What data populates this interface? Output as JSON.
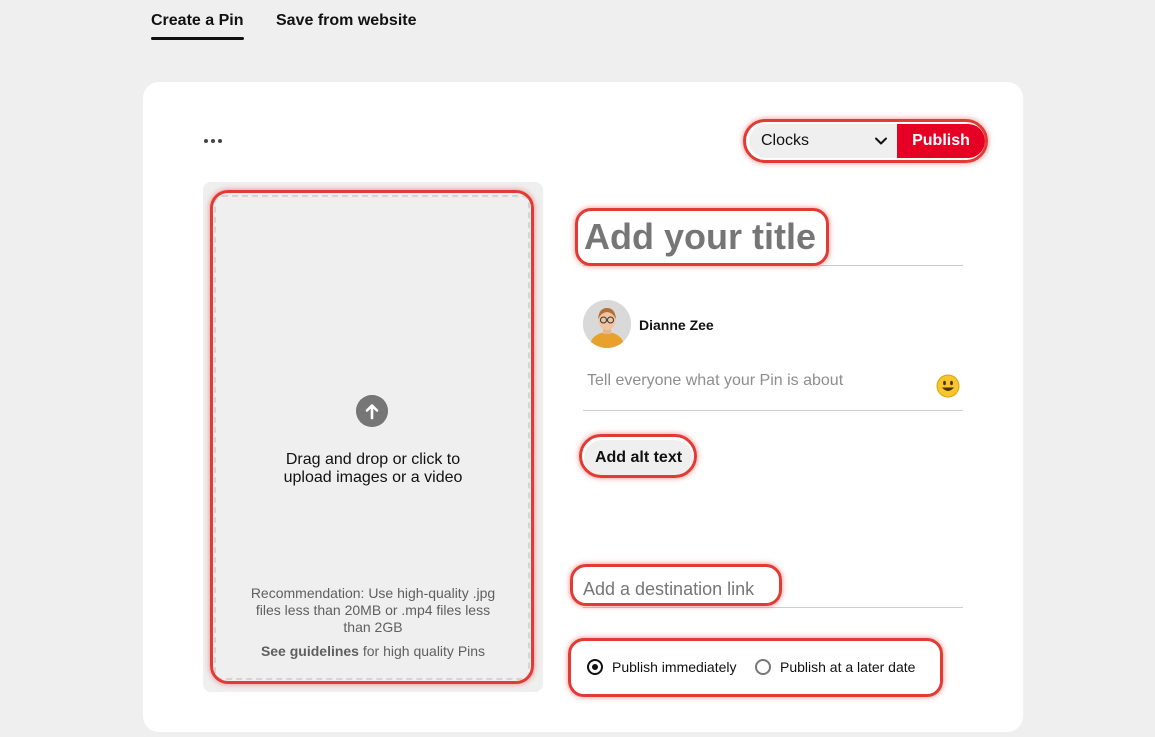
{
  "tabs": [
    {
      "label": "Create a Pin"
    },
    {
      "label": "Save from website"
    }
  ],
  "toolbar": {
    "more_icon": "ellipsis-icon",
    "board_value": "Clocks",
    "publish_label": "Publish"
  },
  "upload": {
    "icon": "upload-arrow-icon",
    "line1": "Drag and drop or click to",
    "line2": "upload images or a video",
    "rec1": "Recommendation: Use high-quality .jpg",
    "rec2": "files less than 20MB or .mp4 files less",
    "rec3": "than 2GB",
    "guidelines_link": "See guidelines",
    "guidelines_rest": " for high quality Pins"
  },
  "form": {
    "title_placeholder": "Add your title",
    "user_name": "Dianne Zee",
    "description_placeholder": "Tell everyone what your Pin is about",
    "emoji_icon": "smiley-emoji-icon",
    "alt_text_label": "Add alt text",
    "link_placeholder": "Add a destination link"
  },
  "publish_options": [
    {
      "label": "Publish immediately",
      "selected": true
    },
    {
      "label": "Publish at a later date",
      "selected": false
    }
  ],
  "colors": {
    "accent": "#e60023",
    "highlight": "#e23b34"
  }
}
